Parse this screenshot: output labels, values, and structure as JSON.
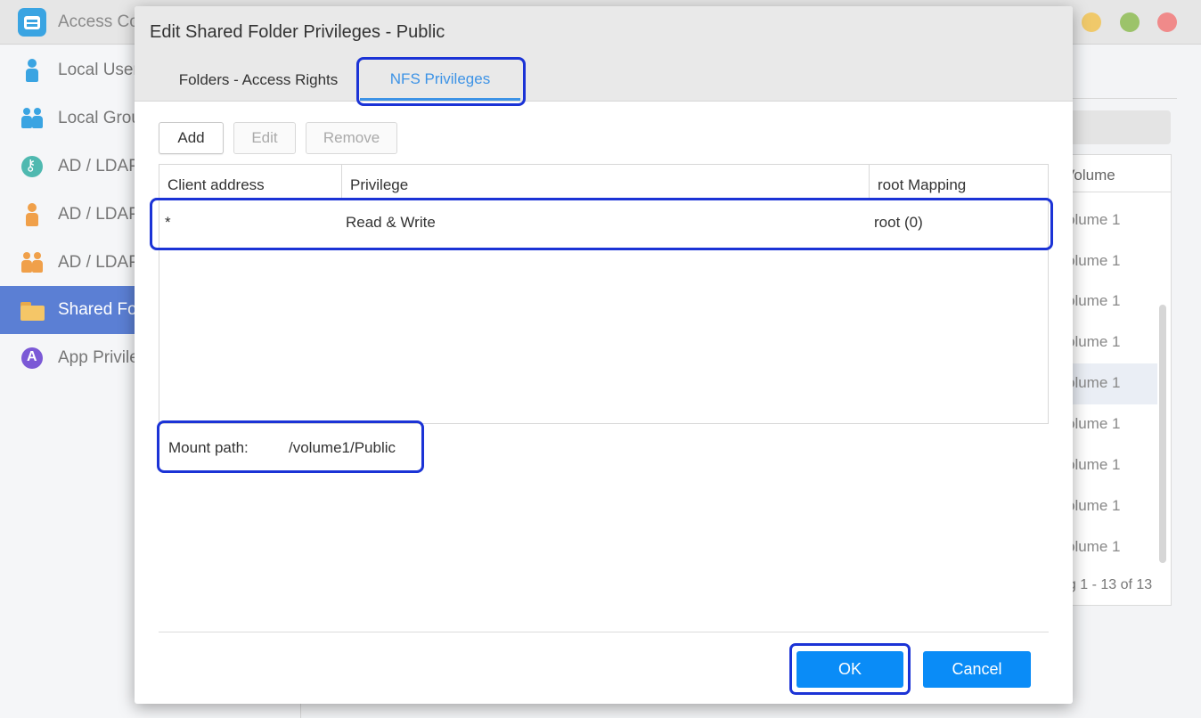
{
  "app": {
    "title": "Access Co",
    "window_controls": [
      "minimize",
      "maximize",
      "close"
    ]
  },
  "sidebar": {
    "items": [
      {
        "label": "Local User",
        "icon": "person-icon"
      },
      {
        "label": "Local Grou",
        "icon": "group-icon"
      },
      {
        "label": "AD / LDAP",
        "icon": "key-icon"
      },
      {
        "label": "AD / LDAP",
        "icon": "person-icon"
      },
      {
        "label": "AD / LDAP",
        "icon": "group-icon"
      },
      {
        "label": "Shared Fol",
        "icon": "folder-icon",
        "active": true
      },
      {
        "label": "App Privile",
        "icon": "app-icon"
      }
    ]
  },
  "background_table": {
    "header": "Volume",
    "rows": [
      "olume 1",
      "olume 1",
      "olume 1",
      "olume 1",
      "olume 1",
      "olume 1",
      "olume 1",
      "olume 1",
      "olume 1"
    ],
    "footer": "ng 1 - 13 of 13"
  },
  "dialog": {
    "title": "Edit Shared Folder Privileges - Public",
    "tabs": [
      {
        "label": "Folders - Access Rights",
        "active": false
      },
      {
        "label": "NFS Privileges",
        "active": true
      }
    ],
    "toolbar": {
      "add_label": "Add",
      "edit_label": "Edit",
      "remove_label": "Remove"
    },
    "table": {
      "columns": [
        "Client address",
        "Privilege",
        "root Mapping"
      ],
      "rows": [
        {
          "client": "*",
          "privilege": "Read & Write",
          "root_mapping": "root (0)"
        }
      ]
    },
    "mount": {
      "label": "Mount path:",
      "value": "/volume1/Public"
    },
    "ok_label": "OK",
    "cancel_label": "Cancel"
  },
  "colors": {
    "accent": "#0a8cf7",
    "tab_active": "#3d93e6",
    "annotation_outline": "#1b33d6",
    "sidebar_active": "#5b7fd4"
  }
}
